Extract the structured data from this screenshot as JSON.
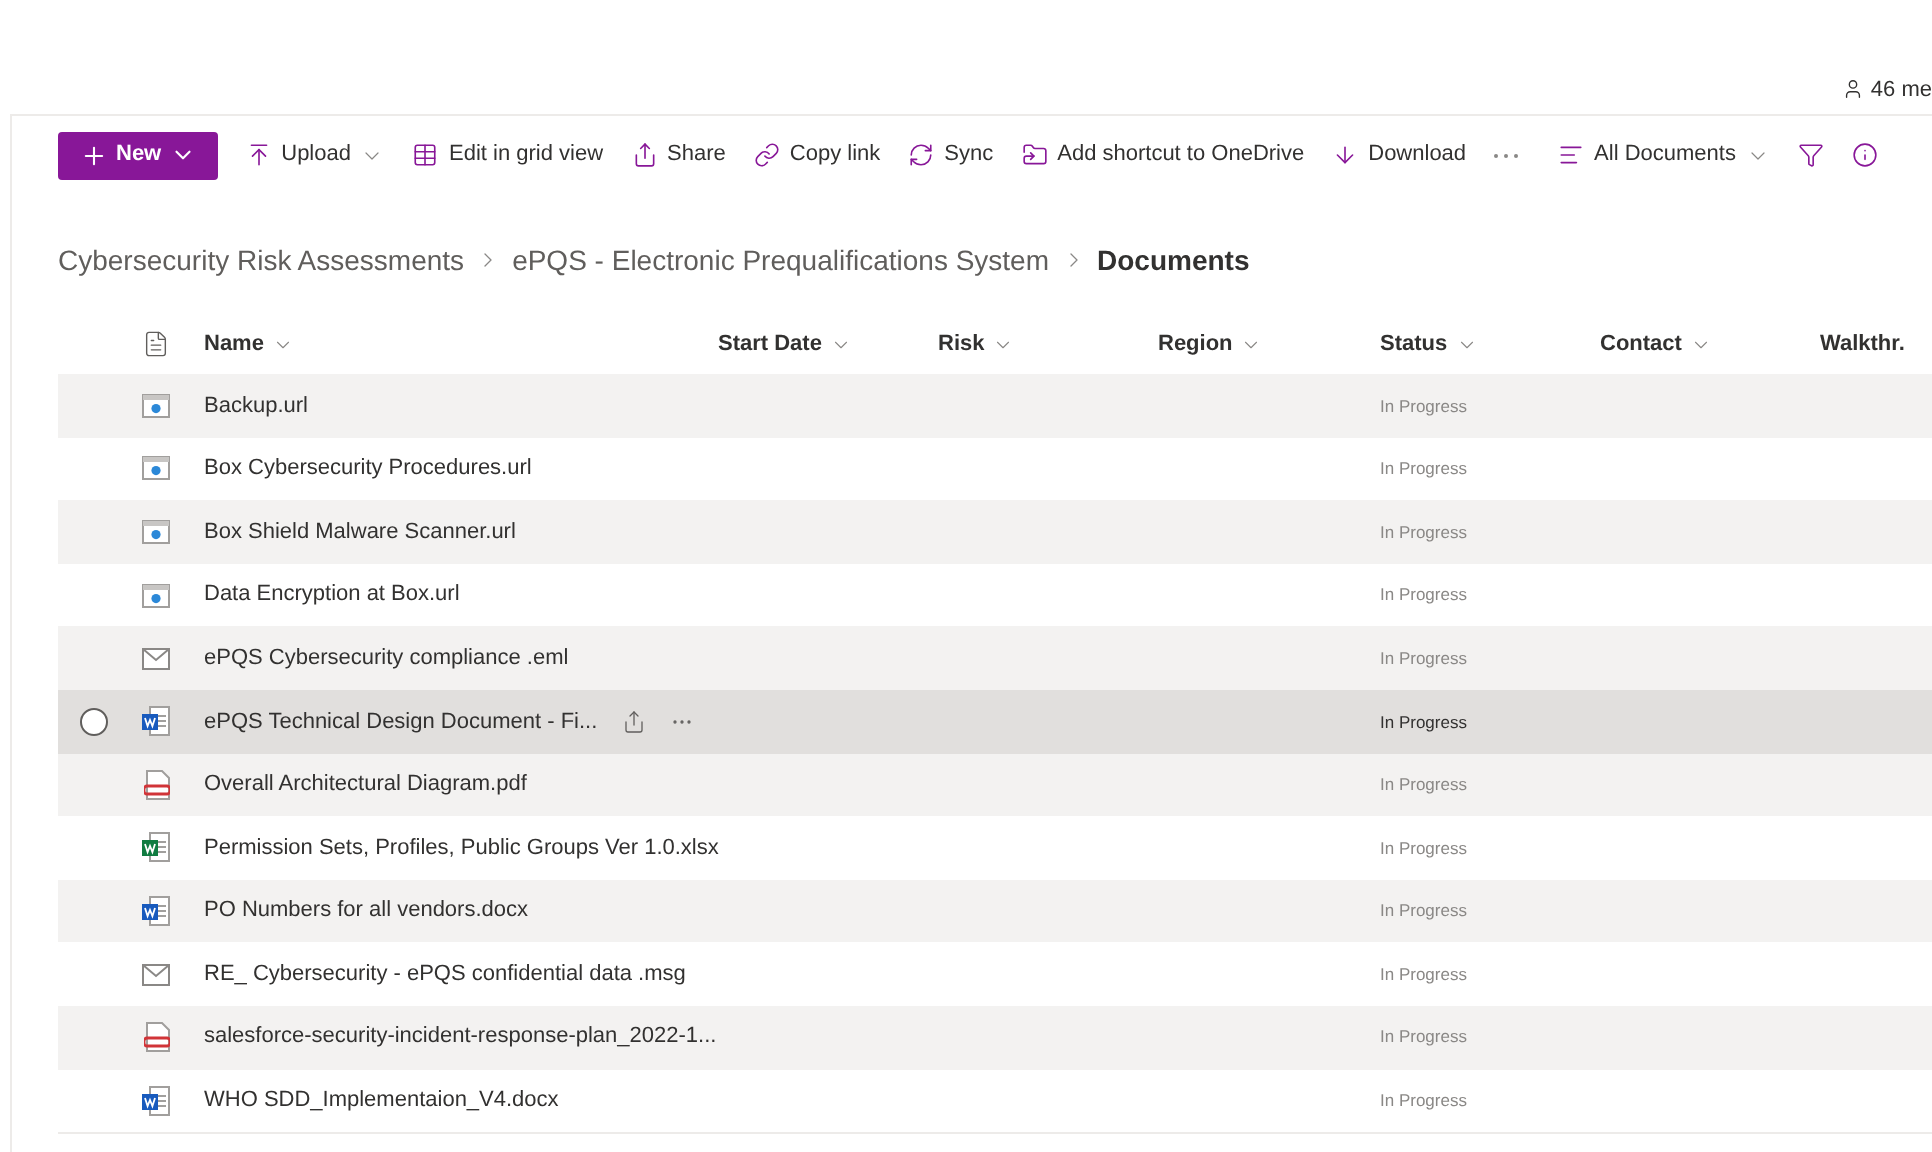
{
  "header": {
    "members": "46 me"
  },
  "toolbar": [
    {
      "kind": "primary",
      "label": "New",
      "dropdown": true
    },
    {
      "kind": "command",
      "label": "Upload",
      "dropdown": true
    },
    {
      "kind": "command",
      "label": "Edit in grid view",
      "dropdown": false
    },
    {
      "kind": "command",
      "label": "Share",
      "dropdown": false
    },
    {
      "kind": "command",
      "label": "Copy link",
      "dropdown": false
    },
    {
      "kind": "command",
      "label": "Sync",
      "dropdown": false
    },
    {
      "kind": "command",
      "label": "Add shortcut to OneDrive",
      "dropdown": false
    },
    {
      "kind": "command",
      "label": "Download",
      "dropdown": false
    },
    {
      "kind": "more"
    },
    {
      "kind": "view",
      "label": "All Documents",
      "dropdown": true
    },
    {
      "kind": "filter"
    },
    {
      "kind": "info"
    }
  ],
  "breadcrumb": [
    "Cybersecurity Risk Assessments",
    "ePQS - Electronic Prequalifications System",
    "Documents"
  ],
  "table": {
    "columns": [
      {
        "label": "Name",
        "dropdown": true
      },
      {
        "label": "Start Date",
        "dropdown": true
      },
      {
        "label": "Risk",
        "dropdown": true
      },
      {
        "label": "Region",
        "dropdown": true
      },
      {
        "label": "Status",
        "dropdown": true
      },
      {
        "label": "Contact",
        "dropdown": true
      },
      {
        "label": "Walkthr.",
        "dropdown": false
      }
    ],
    "rows": [
      {
        "kind": "url",
        "name": "Backup.url",
        "status": "In Progress",
        "hovered": false
      },
      {
        "kind": "url",
        "name": "Box Cybersecurity Procedures.url",
        "status": "In Progress",
        "hovered": false
      },
      {
        "kind": "url",
        "name": "Box Shield Malware Scanner.url",
        "status": "In Progress",
        "hovered": false
      },
      {
        "kind": "url",
        "name": "Data Encryption at Box.url",
        "status": "In Progress",
        "hovered": false
      },
      {
        "kind": "email",
        "name": "ePQS Cybersecurity compliance .eml",
        "status": "In Progress",
        "hovered": false
      },
      {
        "kind": "word",
        "name": "ePQS Technical Design Document - Fi...",
        "status": "In Progress",
        "hovered": true
      },
      {
        "kind": "pdf",
        "name": "Overall Architectural Diagram.pdf",
        "status": "In Progress",
        "hovered": false
      },
      {
        "kind": "excel",
        "name": "Permission Sets, Profiles, Public Groups Ver 1.0.xlsx",
        "status": "In Progress",
        "hovered": false
      },
      {
        "kind": "word",
        "name": "PO Numbers for all vendors.docx",
        "status": "In Progress",
        "hovered": false
      },
      {
        "kind": "email",
        "name": "RE_ Cybersecurity - ePQS confidential data .msg",
        "status": "In Progress",
        "hovered": false
      },
      {
        "kind": "pdf",
        "name": "salesforce-security-incident-response-plan_2022-1...",
        "status": "In Progress",
        "hovered": false
      },
      {
        "kind": "word",
        "name": "WHO SDD_Implementaion_V4.docx",
        "status": "In Progress",
        "hovered": false
      }
    ]
  }
}
